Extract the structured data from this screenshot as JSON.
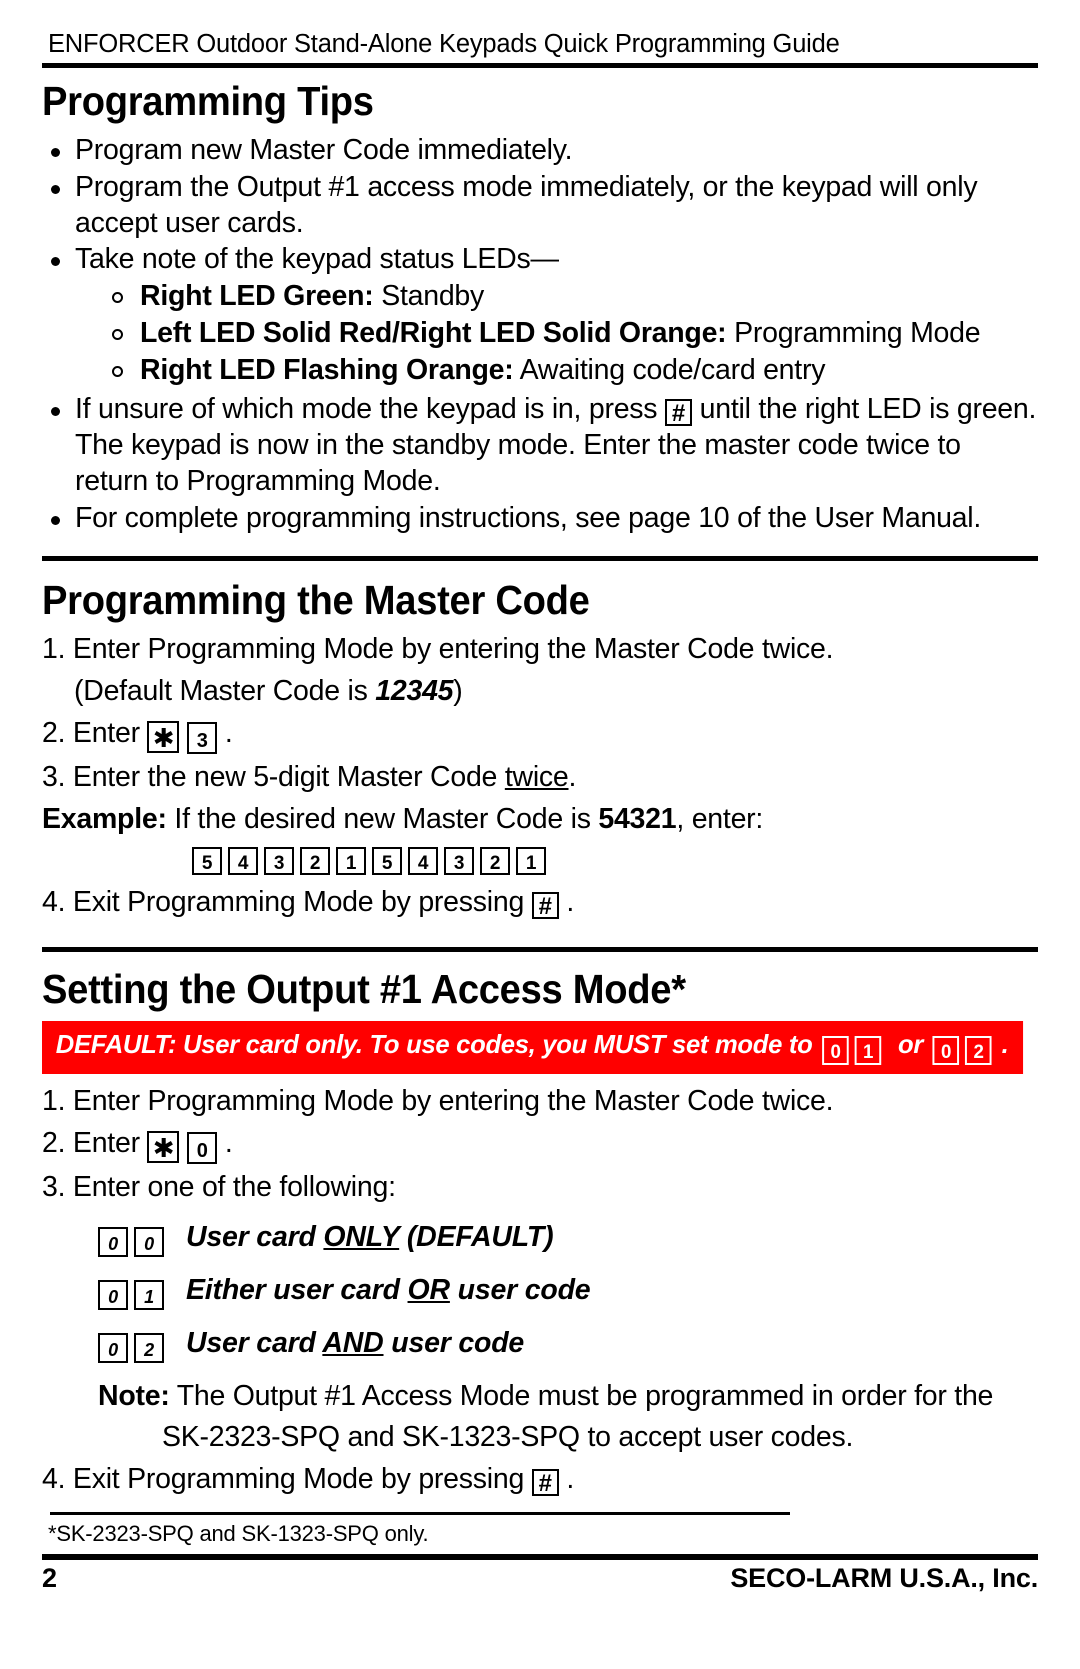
{
  "running_head": "ENFORCER Outdoor Stand-Alone Keypads Quick Programming Guide",
  "sections": {
    "tips": {
      "heading": "Programming Tips",
      "bullets": [
        "Program new Master Code immediately.",
        "Program the Output #1 access mode immediately, or the keypad will only accept user cards.",
        "Take note of the keypad status LEDs—"
      ],
      "led_items": [
        {
          "label": "Right LED Green:",
          "text": "Standby"
        },
        {
          "label": "Left LED Solid Red/Right LED Solid Orange:",
          "text": "Programming Mode"
        },
        {
          "label": "Right LED Flashing Orange:",
          "text": "Awaiting code/card entry"
        }
      ],
      "unsure_part1": "If unsure of which mode the keypad is in, press",
      "unsure_key": "#",
      "unsure_part2": "until the right LED is green. The keypad is now in the standby mode.  Enter the master code twice to return to Programming Mode.",
      "last_bullet": "For complete programming instructions, see page 10 of the User Manual."
    },
    "master_code": {
      "heading": "Programming the Master Code",
      "step1": "1. Enter Programming Mode by entering the Master Code twice.",
      "step1_note_pre": "(Default Master Code is ",
      "step1_note_code": "12345",
      "step1_note_post": ")",
      "step2_pre": "2. Enter",
      "step2_key_star": "✱",
      "step2_key_digit": "3",
      "step2_post": ".",
      "step3_pre": "3. Enter the new 5-digit Master Code ",
      "step3_underline": "twice",
      "step3_post": ".",
      "example_label": "Example:",
      "example_pre": " If the desired new Master Code is ",
      "example_code": "54321",
      "example_post": ", enter:",
      "example_keys": [
        "5",
        "4",
        "3",
        "2",
        "1",
        "5",
        "4",
        "3",
        "2",
        "1"
      ],
      "step4_pre": "4. Exit Programming Mode by pressing",
      "step4_key": "#",
      "step4_post": "."
    },
    "output_mode": {
      "heading": "Setting the Output #1 Access Mode*",
      "banner": {
        "text_pre": "DEFAULT: User card only.  To use codes, you MUST set mode to",
        "keys_a": [
          "0",
          "1"
        ],
        "or": "or",
        "keys_b": [
          "0",
          "2"
        ],
        "text_post": "."
      },
      "step1": "1. Enter Programming Mode by entering the Master Code twice.",
      "step2_pre": "2. Enter",
      "step2_key_star": "✱",
      "step2_key_digit": "0",
      "step2_post": ".",
      "step3": "3. Enter one of the following:",
      "modes": [
        {
          "keys": [
            "0",
            "0"
          ],
          "pre": "User card ",
          "underline": "ONLY",
          "post": " (DEFAULT)"
        },
        {
          "keys": [
            "0",
            "1"
          ],
          "pre": "Either user card ",
          "underline": "OR",
          "post": " user code"
        },
        {
          "keys": [
            "0",
            "2"
          ],
          "pre": "User card ",
          "underline": "AND",
          "post": " user code"
        }
      ],
      "note_label": "Note:",
      "note_text": " The Output #1 Access Mode must be programmed in order for the",
      "note_text_cont": "SK-2323-SPQ and SK-1323-SPQ to accept user codes.",
      "step4_pre": "4. Exit Programming Mode by pressing",
      "step4_key": "#",
      "step4_post": "."
    }
  },
  "footnote": "*SK-2323-SPQ and SK-1323-SPQ only.",
  "footer": {
    "page_number": "2",
    "company": "SECO-LARM U.S.A., Inc."
  },
  "colors": {
    "banner_background": "#FF0000",
    "banner_text": "#FFFFFF",
    "text": "#000000"
  }
}
